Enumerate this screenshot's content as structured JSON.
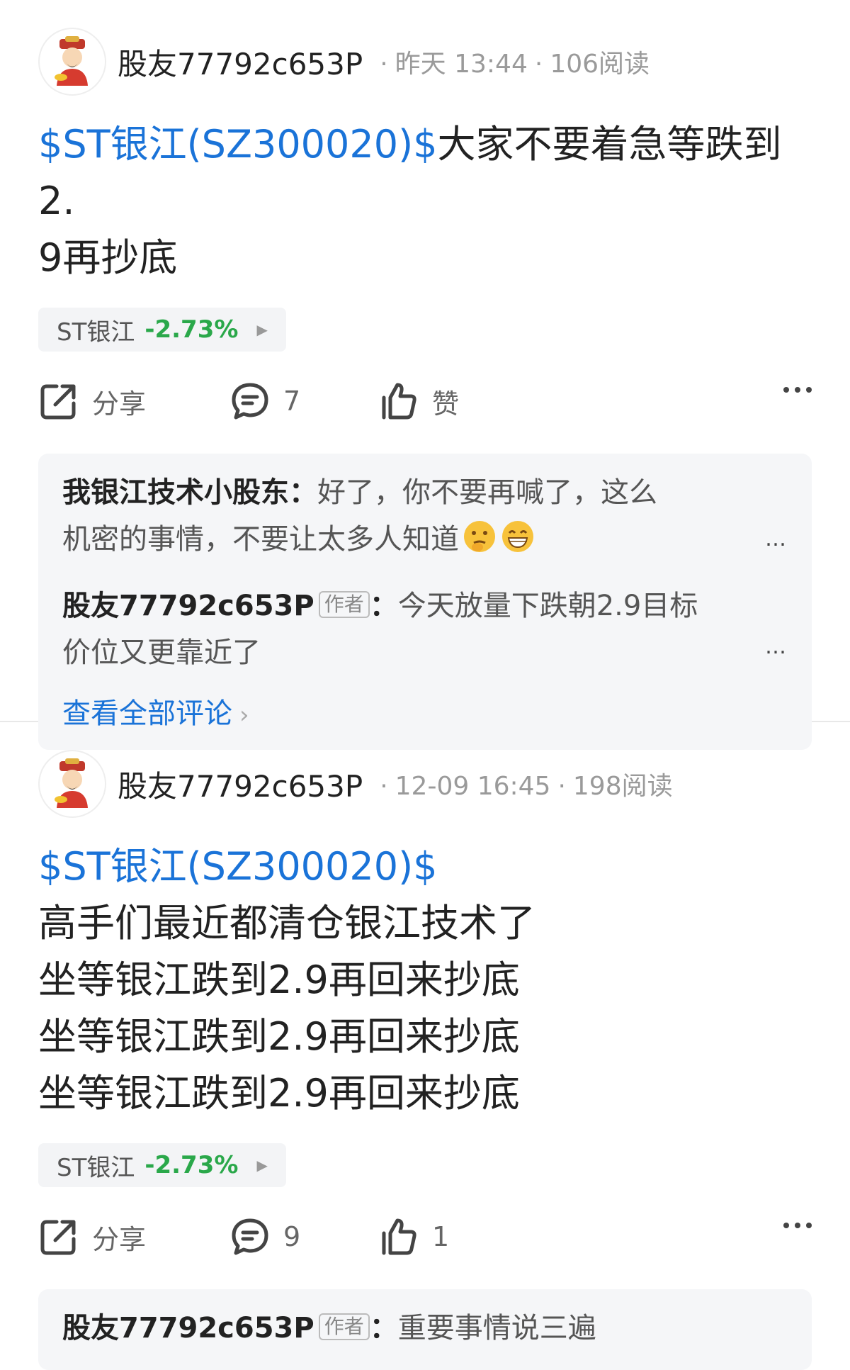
{
  "posts": [
    {
      "author": "股友77792c653P",
      "time": "昨天 13:44",
      "reads": "106阅读",
      "stock_tag": "$ST银江(SZ300020)$",
      "text_lines": [
        "大家不要着急等跌到2.",
        "9再抄底"
      ],
      "chip": {
        "name": "ST银江",
        "change": "-2.73%"
      },
      "actions": {
        "share": "分享",
        "comments": "7",
        "like": "赞"
      },
      "comments": [
        {
          "user": "我银江技术小股东",
          "sep": "：",
          "text_1": "好了，你不要再喊了，这么",
          "text_2": "机密的事情，不要让太多人知道",
          "emojis": [
            "thinking-face-icon",
            "grin-face-icon"
          ]
        },
        {
          "user": "股友77792c653P",
          "badge": "作者",
          "sep": "：",
          "text_1": "今天放量下跌朝2.9目标",
          "text_2": "价位又更靠近了"
        }
      ],
      "view_all": "查看全部评论",
      "more_label": "..."
    },
    {
      "author": "股友77792c653P",
      "time": "12-09 16:45",
      "reads": "198阅读",
      "stock_tag": "$ST银江(SZ300020)$",
      "text_lines": [
        "高手们最近都清仓银江技术了",
        "坐等银江跌到2.9再回来抄底",
        "坐等银江跌到2.9再回来抄底",
        "坐等银江跌到2.9再回来抄底"
      ],
      "chip": {
        "name": "ST银江",
        "change": "-2.73%"
      },
      "actions": {
        "share": "分享",
        "comments": "9",
        "like": "1"
      },
      "comments": [
        {
          "user": "股友77792c653P",
          "badge": "作者",
          "sep": "：",
          "text_1": "重要事情说三遍"
        }
      ]
    }
  ],
  "colors": {
    "link": "#1a73d8",
    "down": "#2aa84a",
    "meta": "#9a9a9a"
  }
}
